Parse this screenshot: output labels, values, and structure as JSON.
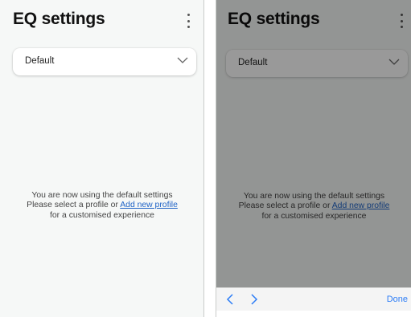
{
  "screen": {
    "title": "EQ settings",
    "profile_select": {
      "selected": "Default"
    },
    "empty_state": {
      "line1": "You are now using the default settings",
      "line2_prefix": "Please select a profile or ",
      "link_text": "Add new profile",
      "line3": "for a customised experience"
    },
    "icons": {
      "menu": "more-vert-icon",
      "dropdown": "chevron-down-icon"
    }
  },
  "keyboard_toolbar": {
    "prev": "chevron-left-icon",
    "next": "chevron-right-icon",
    "done_label": "Done",
    "accent_color": "#2b7cf6"
  },
  "colors": {
    "link": "#1f63c6",
    "background": "#f6f8f7"
  }
}
